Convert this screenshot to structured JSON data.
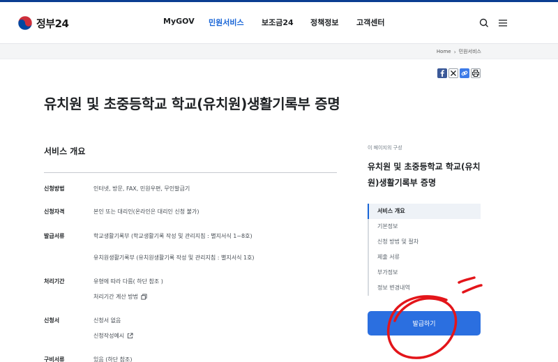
{
  "header": {
    "logo_text": "정부24",
    "nav": [
      {
        "label": "MyGOV",
        "active": false
      },
      {
        "label": "민원서비스",
        "active": true
      },
      {
        "label": "보조금24",
        "active": false
      },
      {
        "label": "정책정보",
        "active": false
      },
      {
        "label": "고객센터",
        "active": false
      }
    ],
    "icons": [
      "search-icon",
      "menu-icon"
    ]
  },
  "breadcrumb": {
    "home": "Home",
    "current": "민원서비스"
  },
  "share_icons": [
    "facebook-icon",
    "x-icon",
    "link-icon",
    "print-icon"
  ],
  "page_title": "유치원 및 초중등학교 학교(유치원)생활기록부 증명",
  "overview": {
    "title": "서비스 개요",
    "rows": {
      "method": {
        "label": "신청방법",
        "value": "인터넷, 방문, FAX, 민원우편, 무인발급기"
      },
      "eligibility": {
        "label": "신청자격",
        "value": "본인 또는 대리인(온라인은 대리인 신청 불가)"
      },
      "documents": {
        "label": "발급서류",
        "value1": "학교생활기록부 (학교생활기록 작성 및 관리지침 : 별지서식 1~8호)",
        "value2": "유치원생활기록부 (유치원생활기록 작성 및 관리지침 : 별지서식 1호)"
      },
      "period": {
        "label": "처리기간",
        "value": "유형에 따라 다름( 하단 참조 )",
        "link": "처리기간 계산 방법"
      },
      "form": {
        "label": "신청서",
        "value": "신청서 없음",
        "link": "신청작성예시"
      },
      "required": {
        "label": "구비서류",
        "value": "있음 (하단 참조)"
      }
    }
  },
  "side": {
    "caption": "이 페이지의 구성",
    "title": "유치원 및 초중등학교 학교(유치원)생활기록부 증명",
    "toc": [
      "서비스 개요",
      "기본정보",
      "신청 방법 및 절차",
      "제출 서류",
      "부가정보",
      "정보 변경내역"
    ],
    "issue_button": "발급하기"
  },
  "colors": {
    "brand": "#1764d6",
    "button": "#2b6fe0",
    "annotation": "#e3151a"
  }
}
